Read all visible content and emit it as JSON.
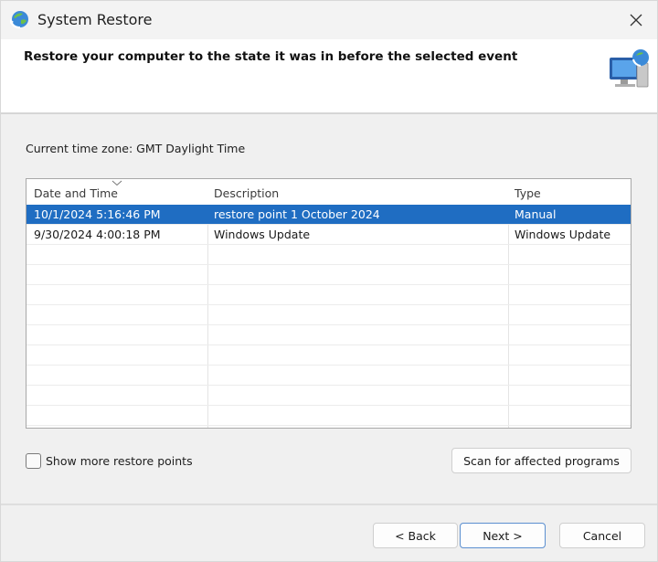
{
  "window": {
    "title": "System Restore",
    "app_icon": "system-restore-icon",
    "close_icon": "close-icon"
  },
  "header": {
    "text": "Restore your computer to the state it was in before the selected event",
    "icon": "computer-restore-icon"
  },
  "timezone_label": "Current time zone: GMT Daylight Time",
  "table": {
    "columns": [
      "Date and Time",
      "Description",
      "Type"
    ],
    "rows": [
      {
        "date": "10/1/2024 5:16:46 PM",
        "description": "restore point 1 October 2024",
        "type": "Manual",
        "selected": true
      },
      {
        "date": "9/30/2024 4:00:18 PM",
        "description": "Windows Update",
        "type": "Windows Update",
        "selected": false
      }
    ],
    "accent": "#1f6dc2"
  },
  "show_more_label": "Show more restore points",
  "show_more_checked": false,
  "scan_button": "Scan for affected programs",
  "buttons": {
    "back": "< Back",
    "next": "Next >",
    "cancel": "Cancel"
  }
}
